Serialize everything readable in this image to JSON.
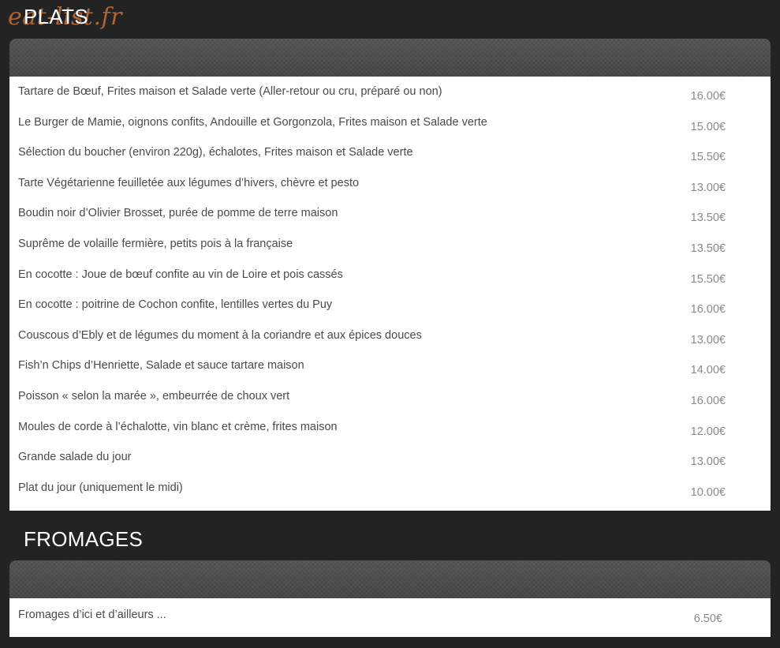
{
  "watermark": "eat-list.fr",
  "sections": [
    {
      "title": "PLATS",
      "items": [
        {
          "name": "Tartare de Bœuf, Frites maison et Salade verte (Aller-retour ou cru, préparé ou non)",
          "price": "16.00€"
        },
        {
          "name": "Le Burger de Mamie, oignons confits, Andouille et Gorgonzola, Frites maison et Salade verte",
          "price": "15.00€"
        },
        {
          "name": "Sélection du boucher (environ 220g), échalotes, Frites maison et Salade verte",
          "price": "15.50€"
        },
        {
          "name": "Tarte Végétarienne feuilletée aux légumes d’hivers, chèvre et pesto",
          "price": "13.00€"
        },
        {
          "name": "Boudin noir d’Olivier Brosset, purée de pomme de terre maison",
          "price": "13.50€"
        },
        {
          "name": "Suprême de volaille fermière, petits pois à la française",
          "price": "13.50€"
        },
        {
          "name": "En cocotte : Joue de bœuf confite au vin de Loire et pois cassés",
          "price": "15.50€"
        },
        {
          "name": "En cocotte : poitrine de Cochon confite, lentilles vertes du Puy",
          "price": "16.00€"
        },
        {
          "name": "Couscous d’Ebly et de légumes du moment à la coriandre et aux épices douces",
          "price": "13.00€"
        },
        {
          "name": "Fish’n Chips d’Henriette, Salade et sauce tartare maison",
          "price": "14.00€"
        },
        {
          "name": "Poisson « selon la marée », embeurrée de choux vert",
          "price": "16.00€"
        },
        {
          "name": "Moules de corde à l’échalotte, vin blanc et crème, frites maison",
          "price": "12.00€"
        },
        {
          "name": "Grande salade du jour",
          "price": "13.00€"
        },
        {
          "name": "Plat du jour (uniquement le midi)",
          "price": "10.00€"
        }
      ]
    },
    {
      "title": "FROMAGES",
      "items": [
        {
          "name": "Fromages d’ici et d’ailleurs ...",
          "price": "6.50€"
        }
      ]
    }
  ]
}
